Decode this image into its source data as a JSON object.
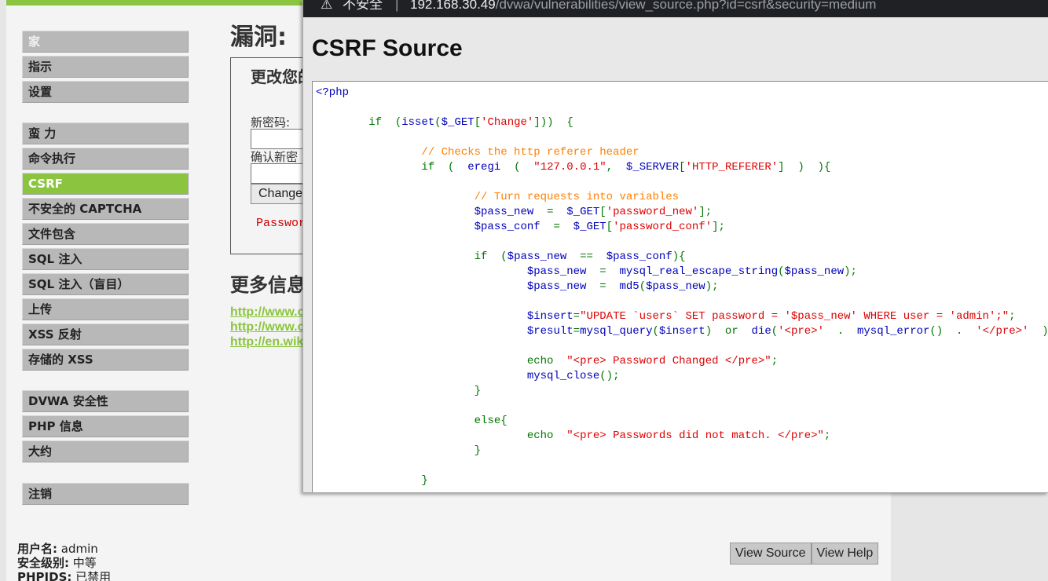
{
  "menu": {
    "group1": [
      "家",
      "指示",
      "设置"
    ],
    "group2": [
      "蛮 力",
      "命令执行",
      "CSRF",
      "不安全的 CAPTCHA",
      "文件包含",
      "SQL 注入",
      "SQL 注入（盲目）",
      "上传",
      "XSS 反射",
      "存储的 XSS"
    ],
    "group3": [
      "DVWA 安全性",
      "PHP 信息",
      "大约"
    ],
    "group4": [
      "注销"
    ],
    "active": "CSRF"
  },
  "main": {
    "title": "漏洞:",
    "form_heading": "更改您的",
    "new_password_label": "新密码:",
    "confirm_password_label": "确认新密",
    "change_button": "Change",
    "message": "Passwor",
    "more_info_heading": "更多信息",
    "links": [
      "http://www.c",
      "http://www.c",
      "http://en.wik"
    ]
  },
  "footer": {
    "username_label": "用户名:",
    "username_value": "admin",
    "security_label": "安全级别:",
    "security_value": "中等",
    "phpids_label": "PHPIDS:",
    "phpids_value": "已禁用",
    "view_source": "View Source",
    "view_help": "View Help"
  },
  "popup": {
    "insecure_label": "不安全",
    "separator": "|",
    "url_host": "192.168.30.49",
    "url_path": "/dvwa/vulnerabilities/view_source.php?id=csrf&security=medium",
    "title": "CSRF Source"
  },
  "code": {
    "open_tag": "<?php",
    "comment_referer": "// Checks the http referer header",
    "comment_turn": "// Turn requests into variables",
    "str_change": "'Change'",
    "str_ip": "\"127.0.0.1\"",
    "str_http_referer": "'HTTP_REFERER'",
    "str_password_new": "'password_new'",
    "str_password_conf": "'password_conf'",
    "str_update": "\"UPDATE `users` SET password = '$pass_new' WHERE user = 'admin';\"",
    "str_pre_open": "'<pre>'",
    "str_pre_close": "'</pre>'",
    "str_changed": "\"<pre> Password Changed </pre>\"",
    "str_mismatch": "\"<pre> Passwords did not match. </pre>\""
  },
  "colors": {
    "accent_green": "#8bc53f",
    "code_default": "#0000bb",
    "code_string": "#dd0000",
    "code_comment": "#ff8000",
    "code_keyword": "#007700"
  }
}
